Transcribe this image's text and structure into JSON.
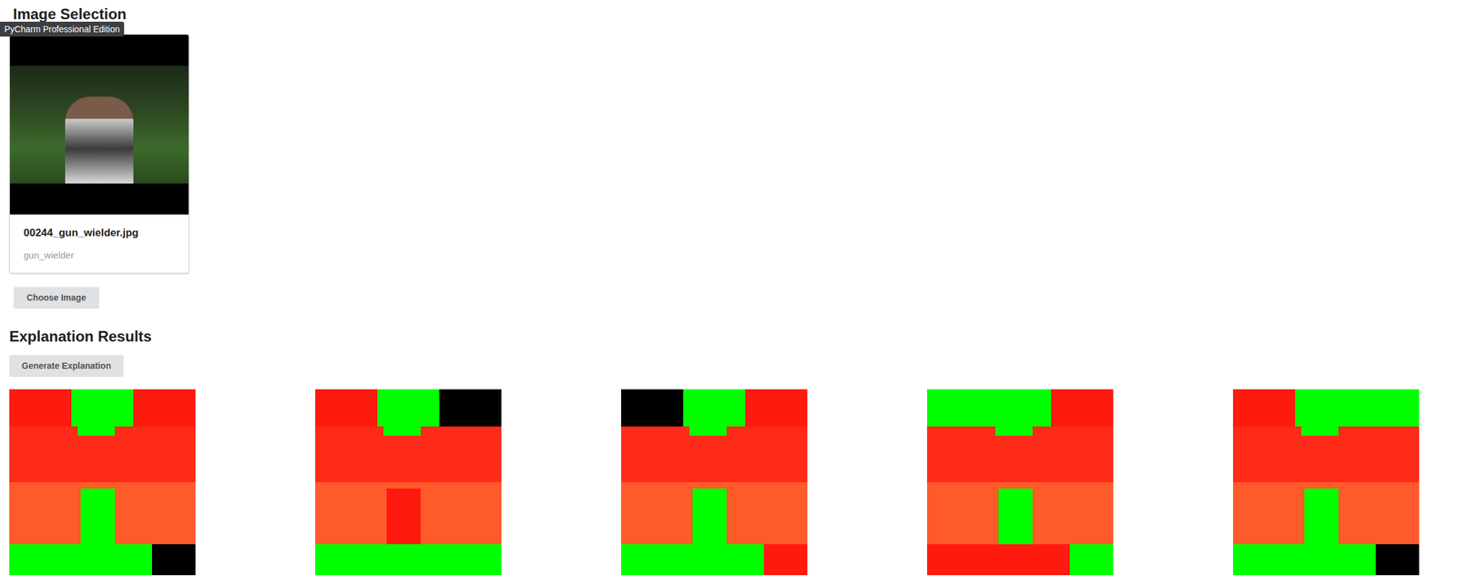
{
  "tooltip": "PyCharm Professional Edition",
  "selection": {
    "title": "Image Selection",
    "card": {
      "filename": "00244_gun_wielder.jpg",
      "label": "gun_wielder"
    },
    "button": "Choose Image"
  },
  "results": {
    "title": "Explanation Results",
    "button": "Generate Explanation"
  }
}
